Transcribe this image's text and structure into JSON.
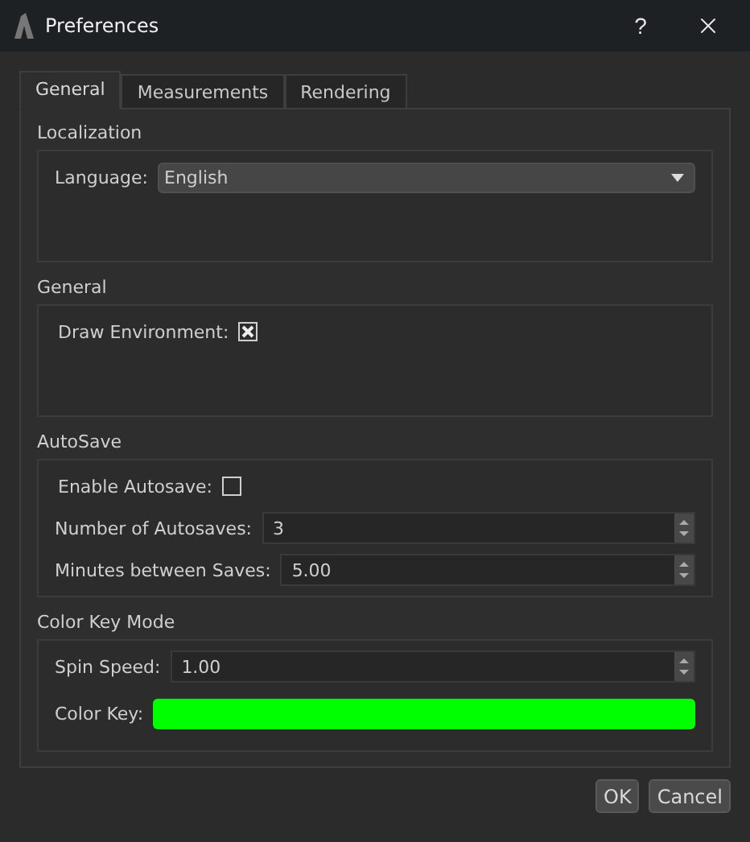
{
  "window": {
    "title": "Preferences",
    "help": "?"
  },
  "tabs": [
    {
      "label": "General",
      "selected": true
    },
    {
      "label": "Measurements",
      "selected": false
    },
    {
      "label": "Rendering",
      "selected": false
    }
  ],
  "sections": [
    {
      "title": "Localization",
      "rows": [
        {
          "kind": "dropdown",
          "label": "Language:",
          "value": "English"
        }
      ]
    },
    {
      "title": "General",
      "rows": [
        {
          "kind": "checkbox",
          "label": "Draw Environment:",
          "checked": true
        }
      ]
    },
    {
      "title": "AutoSave",
      "rows": [
        {
          "kind": "checkbox",
          "label": "Enable Autosave:",
          "checked": false
        },
        {
          "kind": "spinner",
          "label": "Number of Autosaves:",
          "value": "3"
        },
        {
          "kind": "spinner",
          "label": "Minutes between Saves:",
          "value": "5.00"
        }
      ]
    },
    {
      "title": "Color Key Mode",
      "rows": [
        {
          "kind": "spinner",
          "label": "Spin Speed:",
          "value": "1.00"
        },
        {
          "kind": "color",
          "label": "Color Key:",
          "color": "#00ff00"
        }
      ]
    }
  ],
  "buttons": [
    "OK",
    "Cancel"
  ]
}
